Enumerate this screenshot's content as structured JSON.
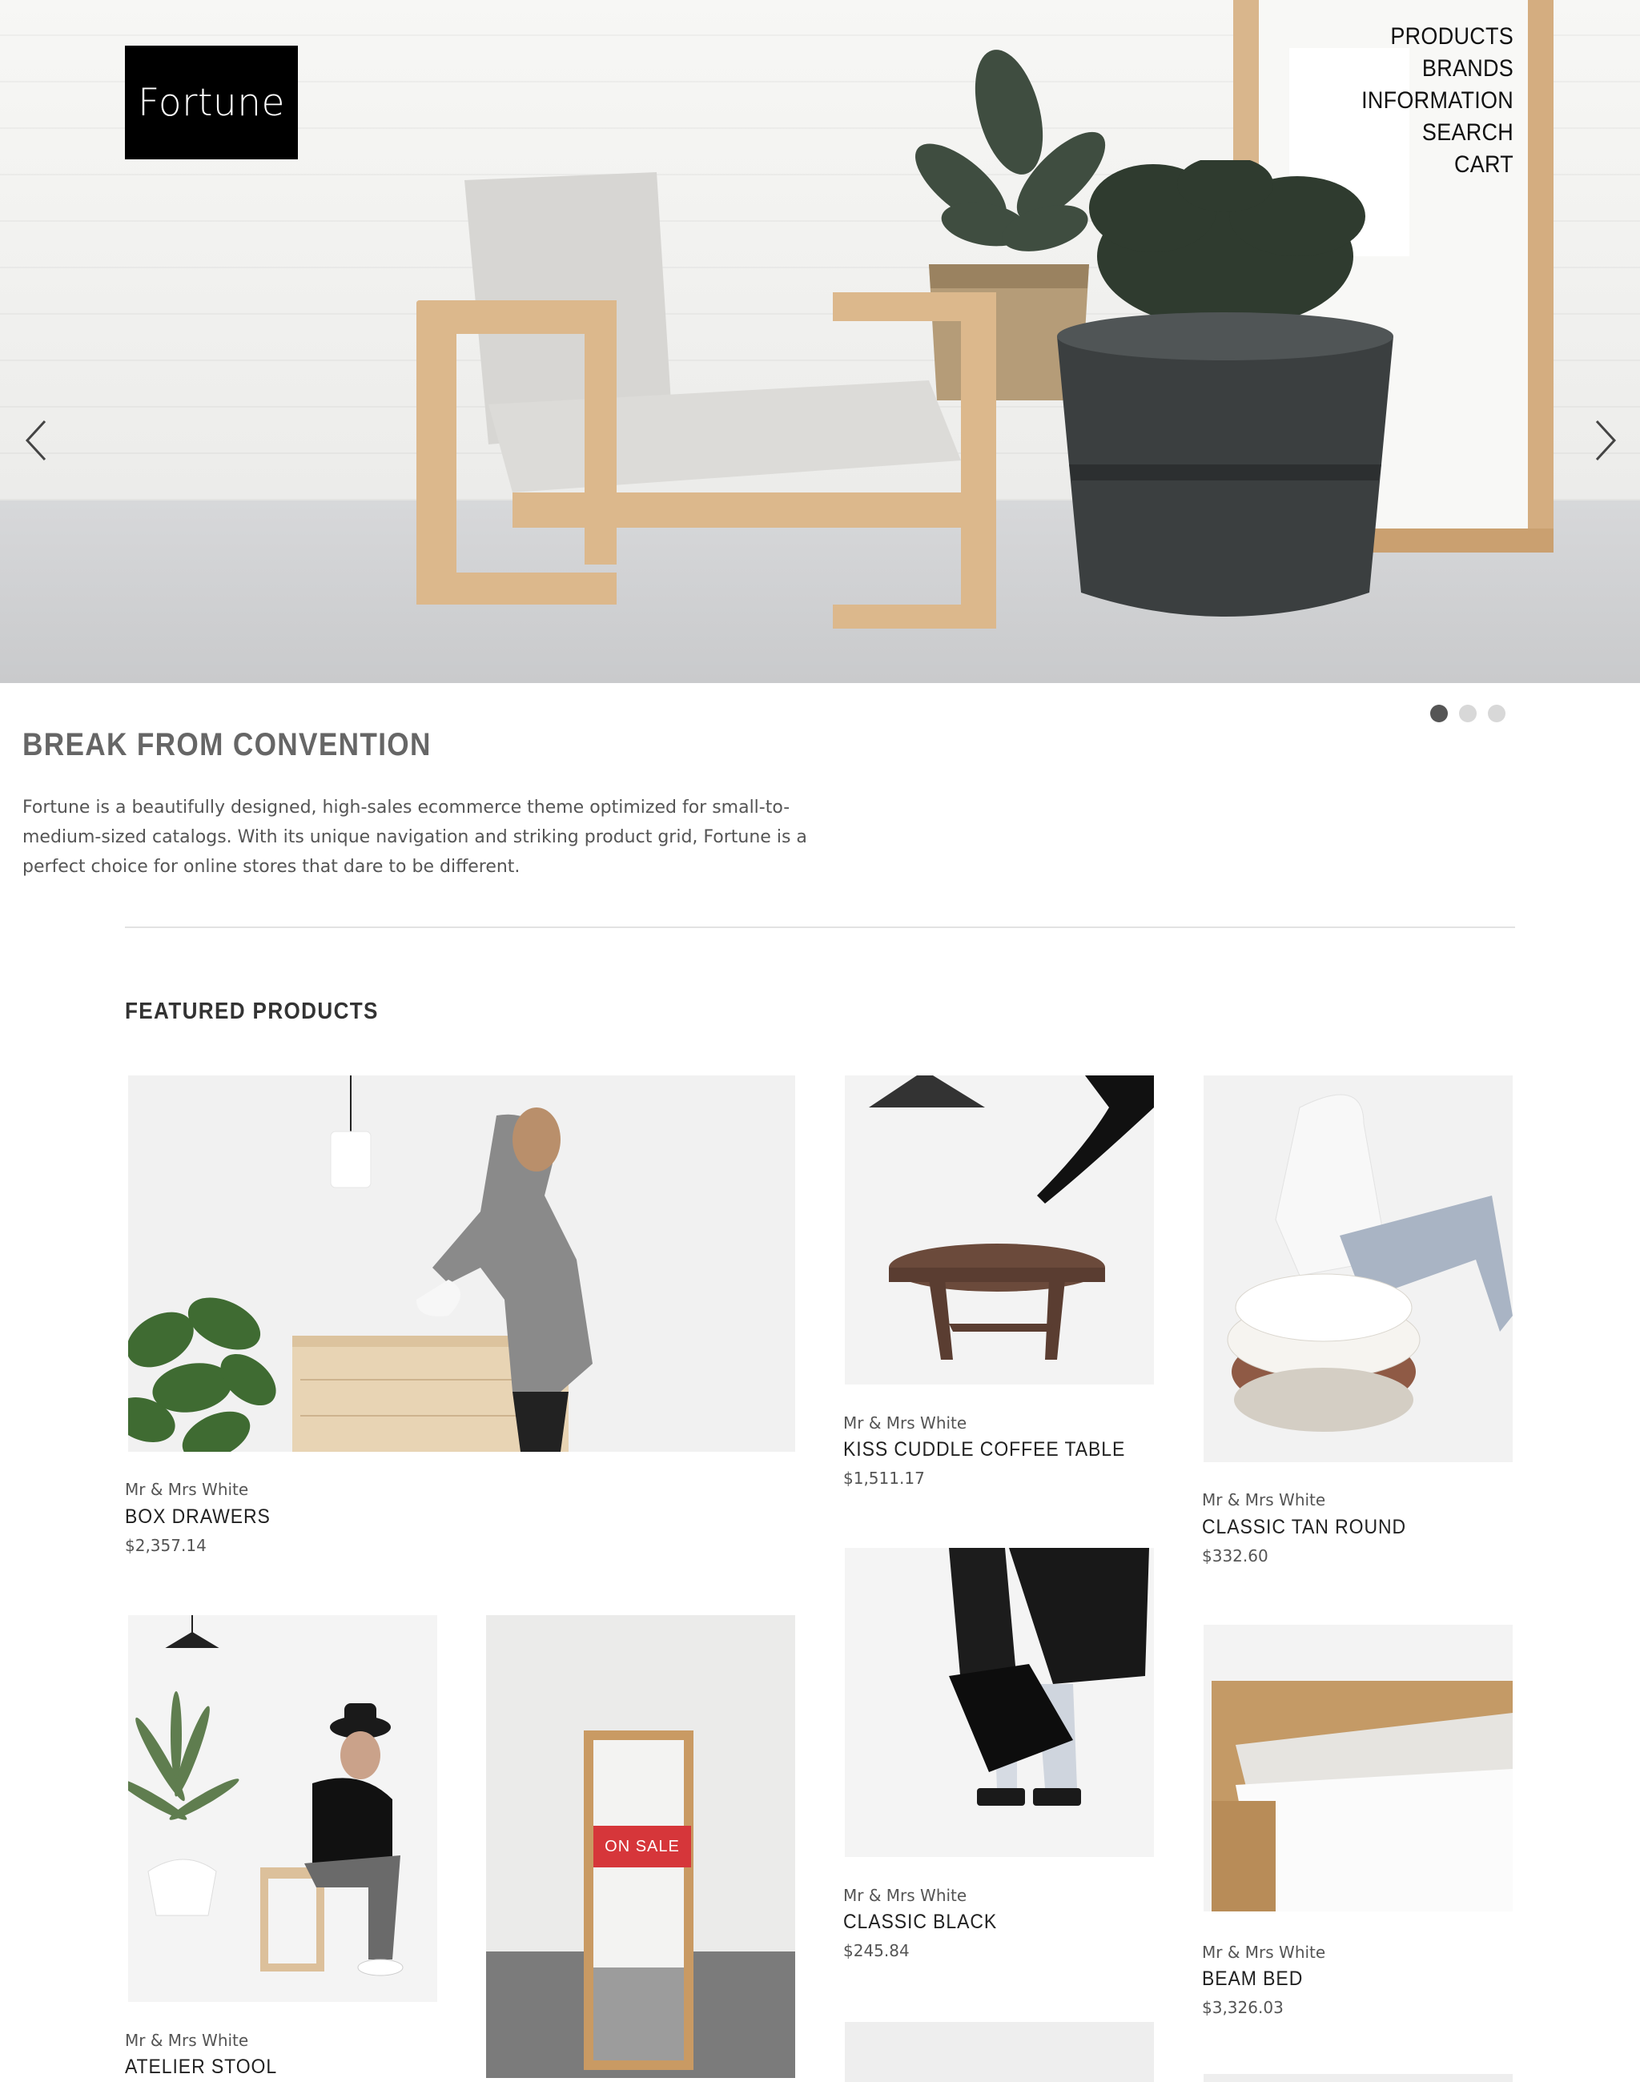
{
  "store": {
    "logo_text": "Fortune"
  },
  "nav": {
    "items": [
      "PRODUCTS",
      "BRANDS",
      "INFORMATION",
      "SEARCH",
      "CART"
    ]
  },
  "hero": {
    "slide_count": 3,
    "active_slide": 1,
    "title": "BREAK FROM CONVENTION",
    "text": "Fortune is a beautifully designed, high-sales ecommerce theme optimized for small-to-medium-sized catalogs. With its unique navigation and striking product grid, Fortune is a perfect choice for online stores that dare to be different."
  },
  "featured": {
    "title": "FEATURED PRODUCTS",
    "products": [
      {
        "brand": "Mr & Mrs White",
        "name": "BOX DRAWERS",
        "price": "$2,357.14"
      },
      {
        "brand": "Mr & Mrs White",
        "name": "KISS CUDDLE COFFEE TABLE",
        "price": "$1,511.17"
      },
      {
        "brand": "Mr & Mrs White",
        "name": "CLASSIC TAN ROUND",
        "price": "$332.60"
      },
      {
        "brand": "Mr & Mrs White",
        "name": "ATELIER STOOL",
        "price": ""
      },
      {
        "brand": "",
        "name": "",
        "price": "",
        "badge": "ON SALE"
      },
      {
        "brand": "Mr & Mrs White",
        "name": "CLASSIC BLACK",
        "price": "$245.84"
      },
      {
        "brand": "Mr & Mrs White",
        "name": "BEAM BED",
        "price": "$3,326.03"
      }
    ]
  },
  "colors": {
    "sale_badge": "#d6363a",
    "dot_active": "#555555",
    "dot_inactive": "#d8d8d8"
  }
}
